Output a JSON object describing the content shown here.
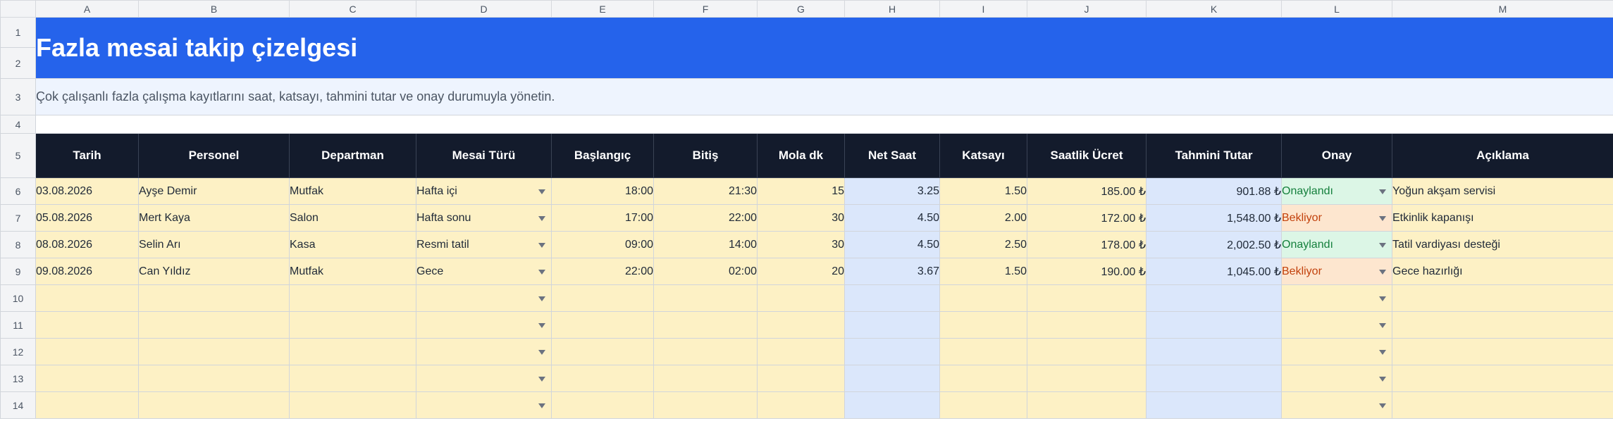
{
  "columns": [
    "A",
    "B",
    "C",
    "D",
    "E",
    "F",
    "G",
    "H",
    "I",
    "J",
    "K",
    "L",
    "M"
  ],
  "row_numbers": [
    "1",
    "2",
    "3",
    "4",
    "5",
    "6",
    "7",
    "8",
    "9",
    "10",
    "11",
    "12",
    "13",
    "14"
  ],
  "title": "Fazla mesai takip çizelgesi",
  "subtitle": "Çok çalışanlı fazla çalışma kayıtlarını saat, katsayı, tahmini tutar ve onay durumuyla yönetin.",
  "headers": [
    "Tarih",
    "Personel",
    "Departman",
    "Mesai Türü",
    "Başlangıç",
    "Bitiş",
    "Mola dk",
    "Net Saat",
    "Katsayı",
    "Saatlik Ücret",
    "Tahmini Tutar",
    "Onay",
    "Açıklama"
  ],
  "rows": [
    {
      "tarih": "03.08.2026",
      "personel": "Ayşe Demir",
      "departman": "Mutfak",
      "mesai_turu": "Hafta içi",
      "baslangic": "18:00",
      "bitis": "21:30",
      "mola": "15",
      "net_saat": "3.25",
      "katsayi": "1.50",
      "saatlik": "185.00 ₺",
      "tutar": "901.88 ₺",
      "onay": "Onaylandı",
      "aciklama": "Yoğun akşam servisi"
    },
    {
      "tarih": "05.08.2026",
      "personel": "Mert Kaya",
      "departman": "Salon",
      "mesai_turu": "Hafta sonu",
      "baslangic": "17:00",
      "bitis": "22:00",
      "mola": "30",
      "net_saat": "4.50",
      "katsayi": "2.00",
      "saatlik": "172.00 ₺",
      "tutar": "1,548.00 ₺",
      "onay": "Bekliyor",
      "aciklama": "Etkinlik kapanışı"
    },
    {
      "tarih": "08.08.2026",
      "personel": "Selin Arı",
      "departman": "Kasa",
      "mesai_turu": "Resmi tatil",
      "baslangic": "09:00",
      "bitis": "14:00",
      "mola": "30",
      "net_saat": "4.50",
      "katsayi": "2.50",
      "saatlik": "178.00 ₺",
      "tutar": "2,002.50 ₺",
      "onay": "Onaylandı",
      "aciklama": "Tatil vardiyası desteği"
    },
    {
      "tarih": "09.08.2026",
      "personel": "Can Yıldız",
      "departman": "Mutfak",
      "mesai_turu": "Gece",
      "baslangic": "22:00",
      "bitis": "02:00",
      "mola": "20",
      "net_saat": "3.67",
      "katsayi": "1.50",
      "saatlik": "190.00 ₺",
      "tutar": "1,045.00 ₺",
      "onay": "Bekliyor",
      "aciklama": "Gece hazırlığı"
    }
  ],
  "colors": {
    "title_bg": "#2563eb",
    "header_bg": "#131b2c",
    "input_cell": "#fdf1c5",
    "calc_cell": "#dbe7fb",
    "approved": "#15803d",
    "pending": "#c2410c"
  },
  "icons": {
    "dropdown": "chevron-down-icon"
  }
}
